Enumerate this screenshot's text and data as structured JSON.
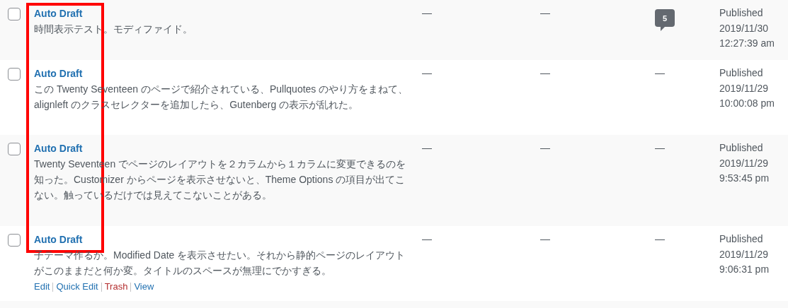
{
  "rows": [
    {
      "checked": false,
      "title": "Auto Draft",
      "excerpt": "時間表示テスト。モディファイド。",
      "column_2": "—",
      "column_3": "—",
      "comments": {
        "kind": "count",
        "text": "5"
      },
      "status": "Published",
      "date": "2019/11/30",
      "time": "12:27:39 am"
    },
    {
      "checked": false,
      "title": "Auto Draft",
      "excerpt": "この Twenty Seventeen のページで紹介されている、Pullquotes のやり方をまねて、alignleft のクラスセレクターを追加したら、Gutenberg の表示が乱れた。",
      "column_2": "—",
      "column_3": "—",
      "comments": {
        "kind": "none",
        "text": "—"
      },
      "status": "Published",
      "date": "2019/11/29",
      "time": "10:00:08 pm"
    },
    {
      "checked": false,
      "title": "Auto Draft",
      "excerpt": "Twenty Seventeen でページのレイアウトを２カラムから１カラムに変更できるのを知った。Customizer からページを表示させないと、Theme Options の項目が出てこない。触っているだけでは見えてこないことがある。",
      "column_2": "—",
      "column_3": "—",
      "comments": {
        "kind": "none",
        "text": "—"
      },
      "status": "Published",
      "date": "2019/11/29",
      "time": "9:53:45 pm"
    },
    {
      "checked": false,
      "title": "Auto Draft",
      "excerpt": "子テーマ作るか。Modified Date を表示させたい。それから静的ページのレイアウトがこのままだと何か変。タイトルのスペースが無理にでかすぎる。",
      "column_2": "—",
      "column_3": "—",
      "comments": {
        "kind": "none",
        "text": "—"
      },
      "status": "Published",
      "date": "2019/11/29",
      "time": "9:06:31 pm"
    }
  ],
  "row_actions": [
    {
      "label": "Edit",
      "kind": "link"
    },
    {
      "label": "Quick Edit",
      "kind": "link"
    },
    {
      "label": "Trash",
      "kind": "delete"
    },
    {
      "label": "View",
      "kind": "link"
    }
  ],
  "highlight": {
    "kind": "box"
  }
}
